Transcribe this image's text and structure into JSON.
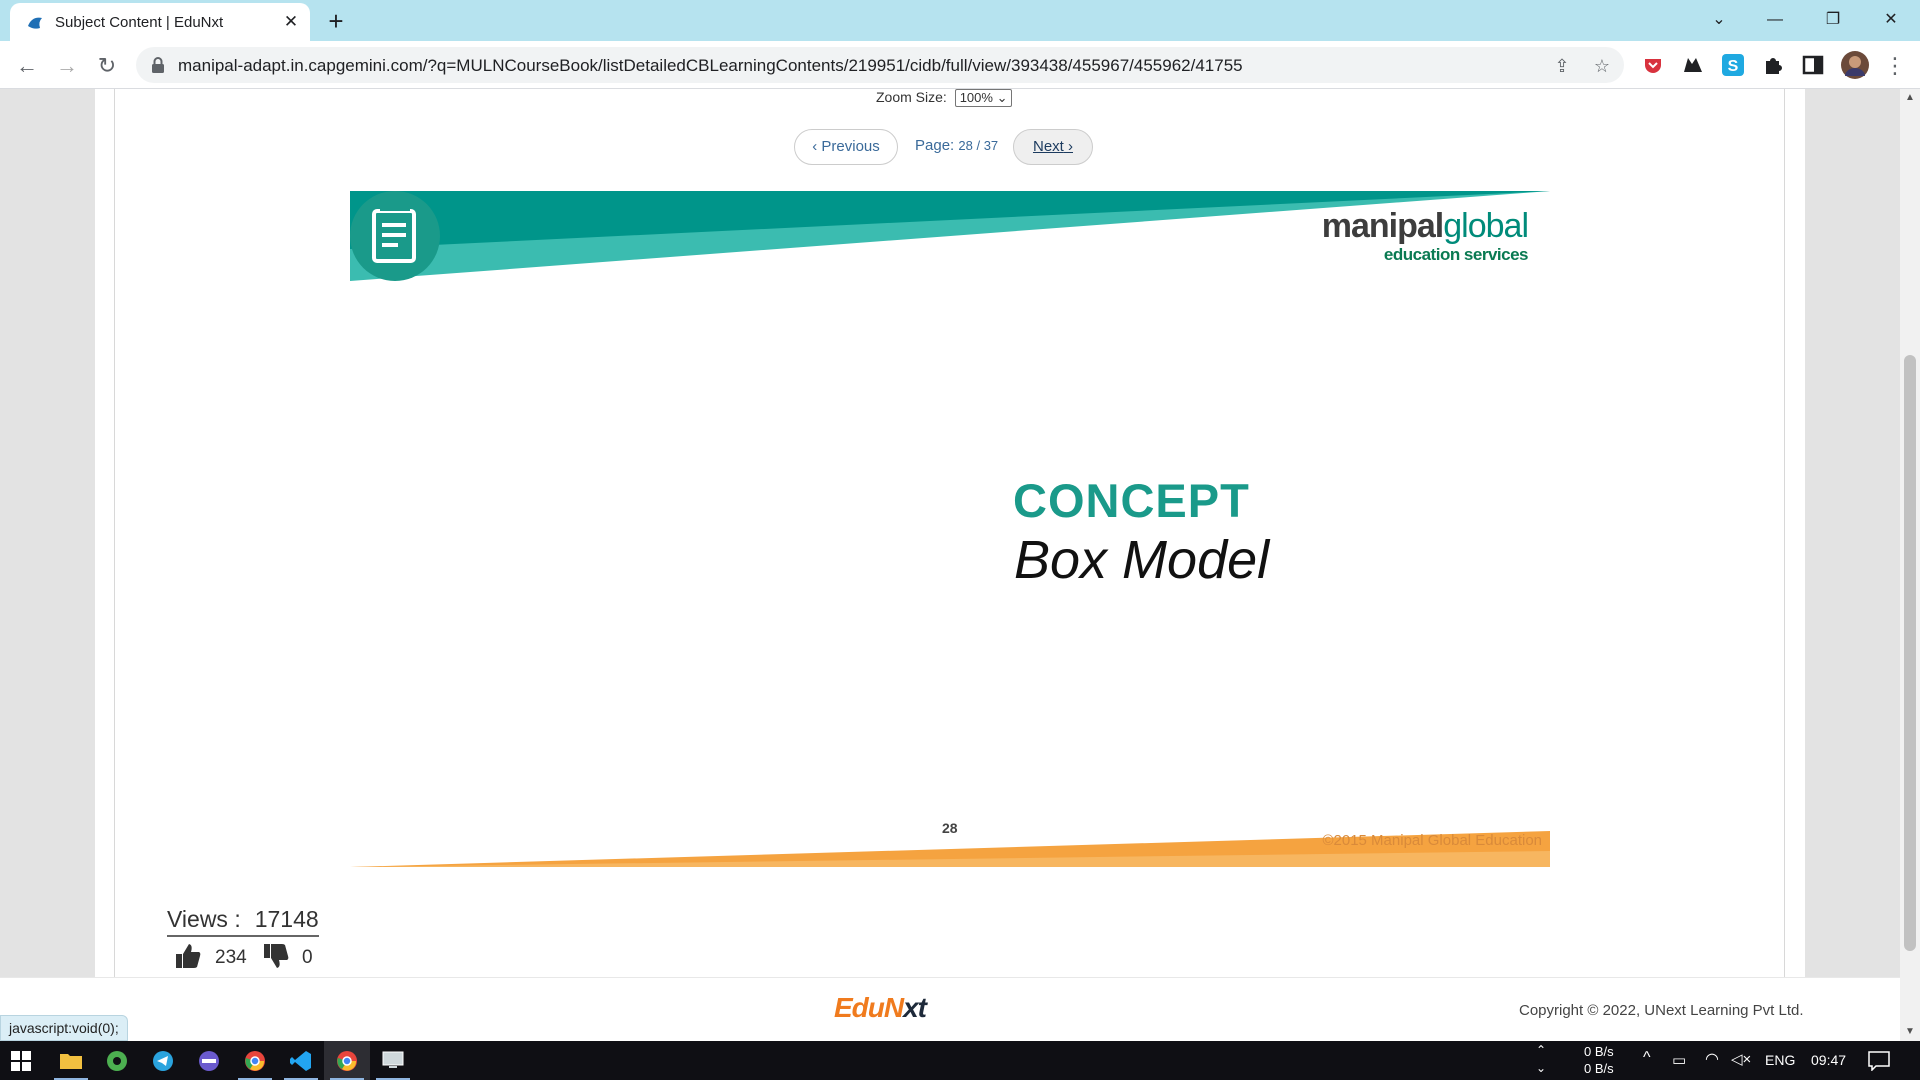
{
  "browser": {
    "tab_title": "Subject Content | EduNxt",
    "url": "manipal-adapt.in.capgemini.com/?q=MULNCourseBook/listDetailedCBLearningContents/219951/cidb/full/view/393438/455967/455962/41755",
    "new_tab": "+",
    "tab_close": "✕"
  },
  "viewer": {
    "zoom_label": "Zoom Size:",
    "zoom_value": "100%",
    "prev_label": "Previous",
    "page_label": "Page:",
    "page_current": "28",
    "page_total": "37",
    "next_label": "Next"
  },
  "slide": {
    "brand_manipal": "manipal",
    "brand_global": "global",
    "brand_sub": "education services",
    "title": "CONCEPT",
    "subtitle": "Box Model",
    "page_number": "28",
    "copyright": "©2015 Manipal Global Education"
  },
  "stats": {
    "views_label": "Views :",
    "views_value": "17148",
    "likes": "234",
    "dislikes": "0"
  },
  "footer": {
    "logo_a": "EduN",
    "logo_b": "xt",
    "copyright": "Copyright © 2022, UNext Learning Pvt Ltd.",
    "status_link": "javascript:void(0);"
  },
  "taskbar": {
    "net_up": "0 B/s",
    "net_down": "0 B/s",
    "lang": "ENG",
    "time": "09:47"
  },
  "colors": {
    "teal": "#00958a",
    "teal_light": "#3bbcb0",
    "orange": "#f5a340",
    "tabstrip": "#b6e3ef"
  }
}
